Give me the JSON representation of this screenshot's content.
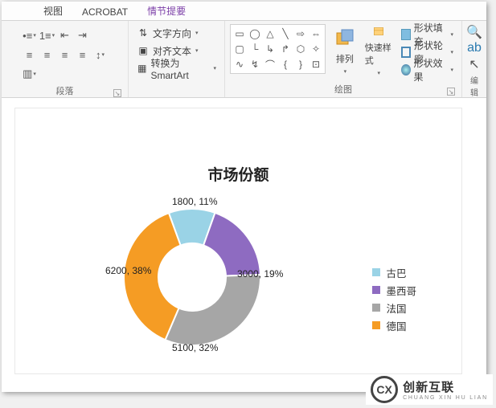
{
  "ribbon": {
    "tabs": {
      "view": "视图",
      "acrobat": "ACROBAT",
      "addin": "情节提要"
    },
    "para_group": {
      "label": "段落",
      "text_direction": "文字方向",
      "align_text": "对齐文本",
      "convert_smartart": "转换为 SmartArt"
    },
    "draw_group": {
      "label": "绘图",
      "arrange": "排列",
      "quick_styles": "快速样式",
      "shape_fill": "形状填充",
      "shape_outline": "形状轮廓",
      "shape_effects": "形状效果"
    },
    "edit_group": {
      "label": "编辑"
    }
  },
  "chart_data": {
    "type": "pie",
    "title": "市场份额",
    "series": [
      {
        "name": "古巴",
        "value": 1800,
        "pct": 11,
        "color": "#9AD3E6",
        "label": "1800, 11%"
      },
      {
        "name": "墨西哥",
        "value": 3000,
        "pct": 19,
        "color": "#8E6BC1",
        "label": "3000, 19%"
      },
      {
        "name": "法国",
        "value": 5100,
        "pct": 32,
        "color": "#A6A6A6",
        "label": "5100, 32%"
      },
      {
        "name": "德国",
        "value": 6200,
        "pct": 38,
        "color": "#F59C24",
        "label": "6200, 38%"
      }
    ]
  },
  "logo": {
    "zh": "创新互联",
    "py": "CHUANG XIN HU LIAN",
    "mark": "CX"
  }
}
